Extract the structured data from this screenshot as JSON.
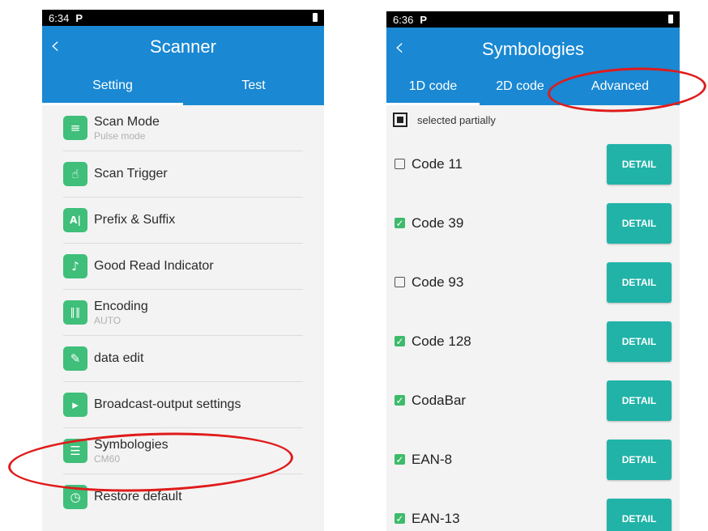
{
  "left": {
    "status_time": "6:34",
    "status_icon": "P",
    "title": "Scanner",
    "tabs": [
      {
        "label": "Setting"
      },
      {
        "label": "Test"
      }
    ],
    "items": [
      {
        "label": "Scan Mode",
        "sub": "Pulse mode",
        "icon": "scan-mode-icon"
      },
      {
        "label": "Scan Trigger",
        "sub": "",
        "icon": "scan-trigger-icon"
      },
      {
        "label": "Prefix & Suffix",
        "sub": "",
        "icon": "prefix-suffix-icon"
      },
      {
        "label": "Good Read Indicator",
        "sub": "",
        "icon": "good-read-indicator-icon"
      },
      {
        "label": "Encoding",
        "sub": "AUTO",
        "icon": "barcode-icon"
      },
      {
        "label": "data edit",
        "sub": "",
        "icon": "data-edit-icon"
      },
      {
        "label": "Broadcast-output settings",
        "sub": "",
        "icon": "broadcast-output-icon"
      },
      {
        "label": "Symbologies",
        "sub": "CM60",
        "icon": "symbologies-icon"
      },
      {
        "label": "Restore default",
        "sub": "",
        "icon": "clock-icon"
      }
    ]
  },
  "right": {
    "status_time": "6:36",
    "status_icon": "P",
    "title": "Symbologies",
    "tabs": [
      {
        "label": "1D code"
      },
      {
        "label": "2D code"
      },
      {
        "label": "Advanced"
      }
    ],
    "partial_label": "selected partially",
    "detail_label": "DETAIL",
    "symbologies": [
      {
        "name": "Code 11",
        "checked": false
      },
      {
        "name": "Code 39",
        "checked": true
      },
      {
        "name": "Code 93",
        "checked": false
      },
      {
        "name": "Code 128",
        "checked": true
      },
      {
        "name": "CodaBar",
        "checked": true
      },
      {
        "name": "EAN-8",
        "checked": true
      },
      {
        "name": "EAN-13",
        "checked": true
      }
    ]
  },
  "colors": {
    "appbar": "#1a88d3",
    "detail_button": "#21b3a8",
    "checkbox_on": "#3dbb6b",
    "highlight": "#e01b1b"
  }
}
